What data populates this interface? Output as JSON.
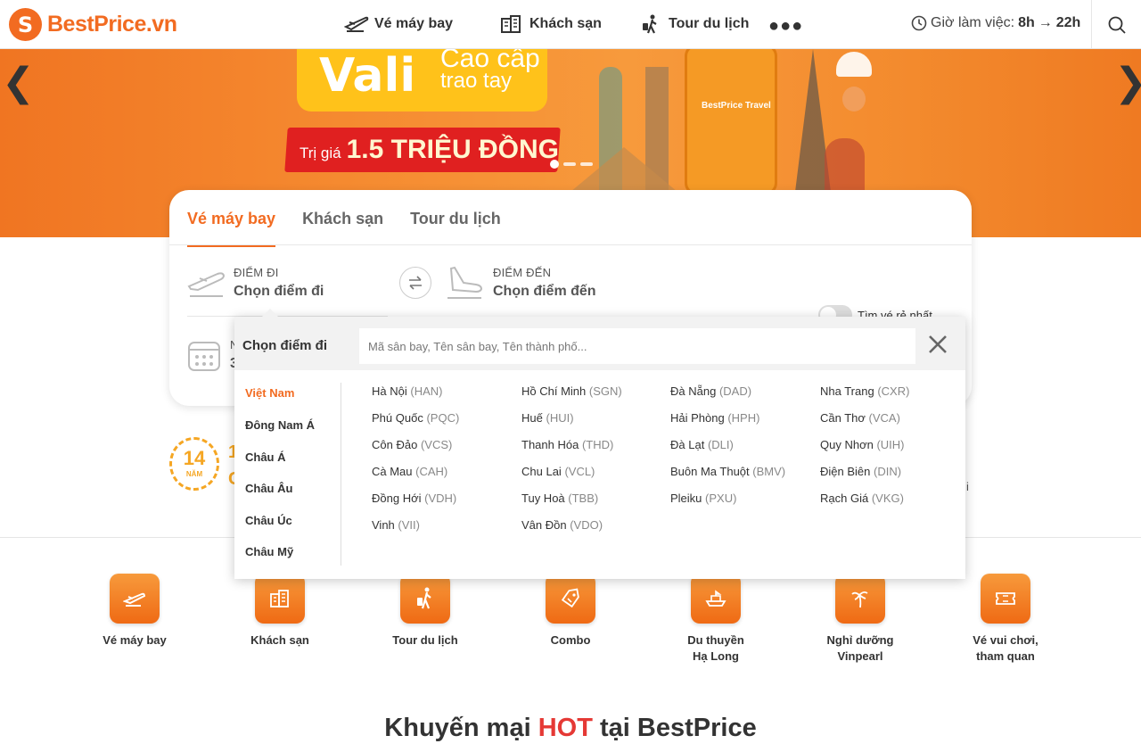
{
  "header": {
    "logo_mark": "S",
    "logo_text": "BestPrice.vn",
    "nav": [
      {
        "label": "Vé máy bay",
        "icon": "plane-icon"
      },
      {
        "label": "Khách sạn",
        "icon": "hotel-icon"
      },
      {
        "label": "Tour du lịch",
        "icon": "traveler-icon"
      }
    ],
    "more": "●●●",
    "hours_label": "Giờ làm việc:",
    "hours_from": "8h",
    "hours_arrow": "→",
    "hours_to": "22h"
  },
  "banner": {
    "headline": "Vali",
    "sub1": "Cao cấp",
    "sub2": "trao tay",
    "price_prefix": "Trị giá",
    "price_value": "1.5 TRIỆU ĐỒNG",
    "suitcase_brand": "BestPrice Travel",
    "prev_arrow": "❮",
    "next_arrow": "❯",
    "slide_count": 3,
    "active_slide": 1
  },
  "search": {
    "tabs": [
      "Vé máy bay",
      "Khách sạn",
      "Tour du lịch"
    ],
    "active_tab": 0,
    "from_label": "ĐIỂM ĐI",
    "from_value": "Chọn điểm đi",
    "to_label": "ĐIỂM ĐẾN",
    "to_value": "Chọn điểm đến",
    "cheapest_label": "Tìm vé rẻ nhất",
    "cheapest_on": false,
    "date_label_partial": "N",
    "date_value_partial": "3"
  },
  "dropdown": {
    "title": "Chọn điểm đi",
    "placeholder": "Mã sân bay, Tên sân bay, Tên thành phố...",
    "regions": [
      "Việt Nam",
      "Đông Nam Á",
      "Châu Á",
      "Châu Âu",
      "Châu Úc",
      "Châu Mỹ"
    ],
    "active_region": 0,
    "airports": [
      [
        {
          "city": "Hà Nội",
          "code": "(HAN)"
        },
        {
          "city": "Phú Quốc",
          "code": "(PQC)"
        },
        {
          "city": "Côn Đảo",
          "code": "(VCS)"
        },
        {
          "city": "Cà Mau",
          "code": "(CAH)"
        },
        {
          "city": "Đồng Hới",
          "code": "(VDH)"
        },
        {
          "city": "Vinh",
          "code": "(VII)"
        }
      ],
      [
        {
          "city": "Hồ Chí Minh",
          "code": "(SGN)"
        },
        {
          "city": "Huế",
          "code": "(HUI)"
        },
        {
          "city": "Thanh Hóa",
          "code": "(THD)"
        },
        {
          "city": "Chu Lai",
          "code": "(VCL)"
        },
        {
          "city": "Tuy Hoà",
          "code": "(TBB)"
        },
        {
          "city": "Vân Đồn",
          "code": "(VDO)"
        }
      ],
      [
        {
          "city": "Đà Nẵng",
          "code": "(DAD)"
        },
        {
          "city": "Hải Phòng",
          "code": "(HPH)"
        },
        {
          "city": "Đà Lạt",
          "code": "(DLI)"
        },
        {
          "city": "Buôn Ma Thuột",
          "code": "(BMV)"
        },
        {
          "city": "Pleiku",
          "code": "(PXU)"
        }
      ],
      [
        {
          "city": "Nha Trang",
          "code": "(CXR)"
        },
        {
          "city": "Cần Thơ",
          "code": "(VCA)"
        },
        {
          "city": "Quy Nhơn",
          "code": "(UIH)"
        },
        {
          "city": "Điện Biên",
          "code": "(DIN)"
        },
        {
          "city": "Rạch Giá",
          "code": "(VKG)"
        }
      ]
    ]
  },
  "badge": {
    "years": "14",
    "unit": "NĂM",
    "partial_1": "1",
    "partial_2": "C",
    "partial_right": "i"
  },
  "services": [
    {
      "label": "Vé máy bay",
      "icon": "plane-icon"
    },
    {
      "label": "Khách sạn",
      "icon": "hotel-icon"
    },
    {
      "label": "Tour du lịch",
      "icon": "traveler-icon"
    },
    {
      "label": "Combo",
      "icon": "ticket-tag-icon"
    },
    {
      "label": "Du thuyền\nHạ Long",
      "icon": "cruise-icon"
    },
    {
      "label": "Nghỉ dưỡng\nVinpearl",
      "icon": "palm-icon"
    },
    {
      "label": "Vé vui chơi,\ntham quan",
      "icon": "ticket-icon"
    }
  ],
  "promo": {
    "prefix": "Khuyến mại",
    "hot": "HOT",
    "suffix": "tại BestPrice"
  },
  "colors": {
    "brand": "#f26b21",
    "hot": "#e53935"
  }
}
